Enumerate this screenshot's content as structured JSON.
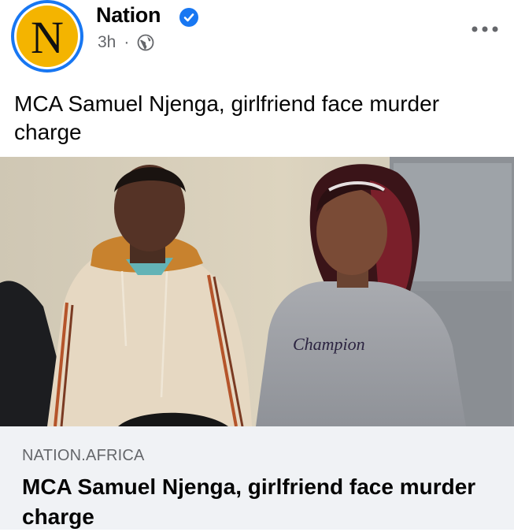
{
  "post": {
    "page_name": "Nation",
    "avatar_letter": "N",
    "time": "3h",
    "separator": "·",
    "audience_icon": "globe-icon",
    "more_icon": "more-options-icon",
    "verified_icon": "verified-badge-icon",
    "text": "MCA Samuel Njenga, girlfriend face murder charge"
  },
  "photo": {
    "sweatshirt_text": "Champion"
  },
  "link_preview": {
    "domain": "NATION.AFRICA",
    "title": "MCA Samuel Njenga, girlfriend face murder charge"
  },
  "colors": {
    "verified": "#1877f2",
    "avatar_bg": "#f4b400",
    "meta_text": "#65676b",
    "link_bg": "#f0f2f5"
  }
}
